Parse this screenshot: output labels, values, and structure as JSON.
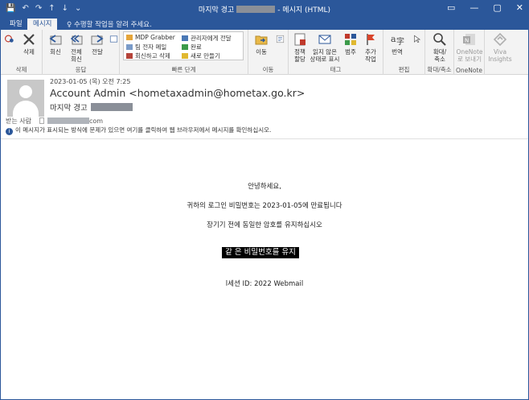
{
  "titlebar": {
    "title_left": "마지막 경고",
    "title_right": "- 메시지 (HTML)",
    "qat": [
      "💾",
      "↶",
      "↷",
      "↑",
      "↓",
      "⌄"
    ],
    "controls": [
      "▭",
      "—",
      "▢",
      "✕"
    ]
  },
  "tabs": {
    "file": "파일",
    "message": "메시지",
    "tell_me": "수행할 작업을 알려 주세요."
  },
  "ribbon": {
    "delete": {
      "junk_icon": "junk-icon",
      "delete_label": "삭제",
      "group": "삭제"
    },
    "respond": {
      "reply": "회신",
      "reply_all_1": "전체",
      "reply_all_2": "회신",
      "forward": "전달",
      "group": "응답"
    },
    "quick_steps": {
      "items": [
        "MDP Grabber",
        "팀 전자 메일",
        "회신하고 삭제",
        "관리자에게 전달",
        "완료",
        "새로 만들기"
      ],
      "group": "빠른 단계"
    },
    "move": {
      "move": "이동",
      "group": "이동"
    },
    "tags": {
      "policy_1": "정책",
      "policy_2": "할당",
      "unread_1": "읽지 않은",
      "unread_2": "상태로 표시",
      "categorize": "범주",
      "followup_1": "추가",
      "followup_2": "작업",
      "group": "태그"
    },
    "editing": {
      "translate": "번역",
      "group": "편집"
    },
    "zoom": {
      "zoom_1": "확대/",
      "zoom_2": "축소",
      "group": "확대/축소"
    },
    "onenote": {
      "label_1": "OneNote",
      "label_2": "로 보내기",
      "group": "OneNote"
    },
    "viva": {
      "label_1": "Viva",
      "label_2": "Insights"
    }
  },
  "header": {
    "date": "2023-01-05 (목) 오전 7:25",
    "sender": "Account Admin <hometaxadmin@hometax.go.kr>",
    "subject": "마지막 경고",
    "to_label": "받는 사람",
    "to_suffix": "com",
    "info": "이 메시지가 표시되는 방식에 문제가 있으면 여기를 클릭하여 웹 브라우저에서 메시지를 확인하십시오."
  },
  "body": {
    "greeting": "안녕하세요,",
    "line1": "귀하의 로그인 비밀번호는 2023-01-05에 만료됩니다",
    "line2": "장기기 전에 동일한 암호를 유지하십시오",
    "button": "같 은 비밀번호를 유지",
    "footer": "l세션 ID:  2022   Webmail"
  },
  "colors": {
    "accent": "#2b579a",
    "ribbon": "#f3f3f3",
    "button_bg": "#000000"
  }
}
